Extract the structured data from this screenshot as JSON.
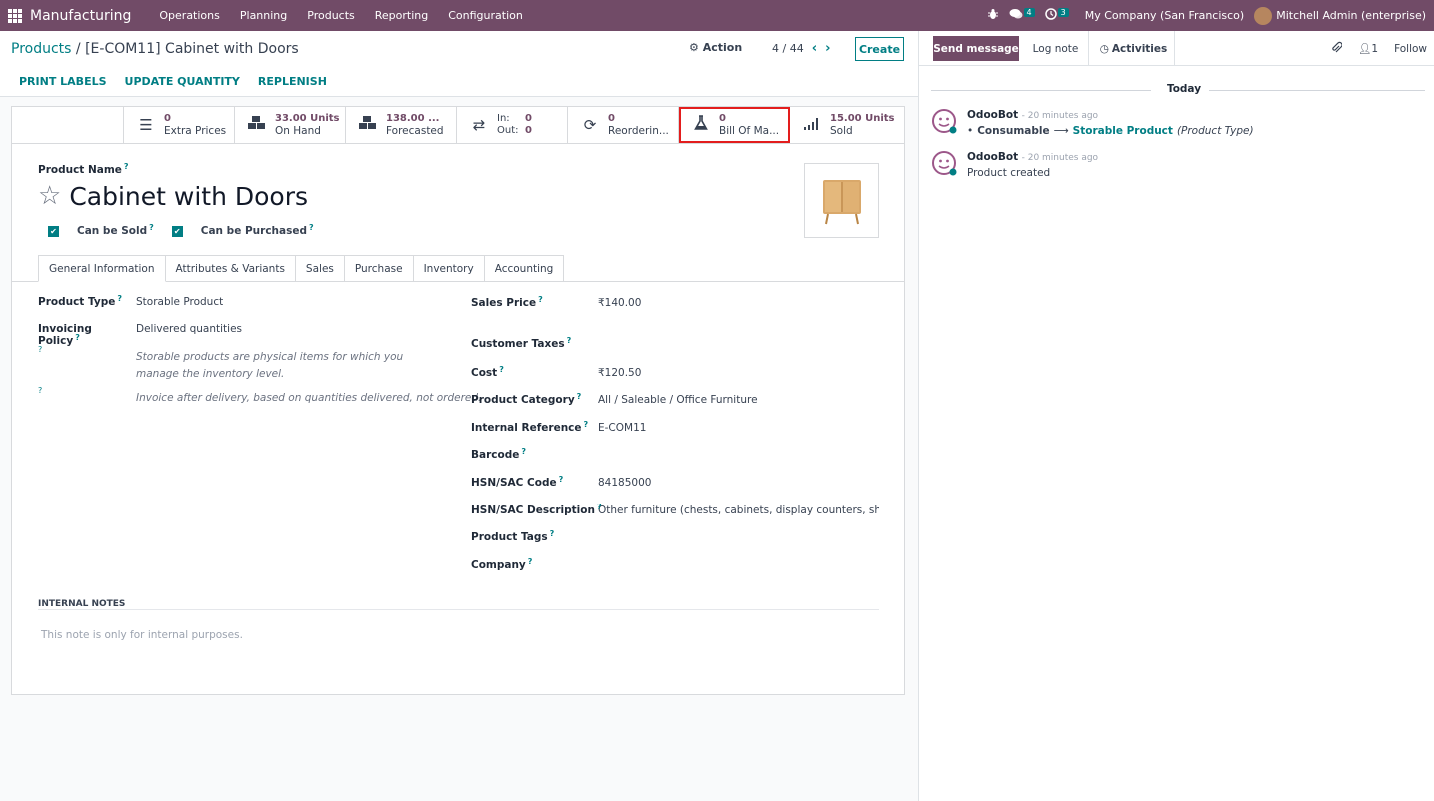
{
  "topbar": {
    "app_name": "Manufacturing",
    "menu": [
      "Operations",
      "Planning",
      "Products",
      "Reporting",
      "Configuration"
    ],
    "messages_count": "4",
    "activities_count": "3",
    "company": "My Company (San Francisco)",
    "user": "Mitchell Admin (enterprise)"
  },
  "control": {
    "breadcrumb_root": "Products",
    "breadcrumb_sep": "/",
    "breadcrumb_current": "[E-COM11] Cabinet with Doors",
    "action_label": "Action",
    "pager_value": "4 / 44",
    "create_label": "Create",
    "buttons": [
      "PRINT LABELS",
      "UPDATE QUANTITY",
      "REPLENISH"
    ]
  },
  "stats": {
    "extra_prices": {
      "value": "0",
      "label": "Extra Prices"
    },
    "on_hand": {
      "value": "33.00 Units",
      "label": "On Hand"
    },
    "forecasted": {
      "value": "138.00 ...",
      "label": "Forecasted"
    },
    "in_out": {
      "in_label": "In:",
      "in_value": "0",
      "out_label": "Out:",
      "out_value": "0"
    },
    "reordering": {
      "value": "0",
      "label": "Reorderin..."
    },
    "bom": {
      "value": "0",
      "label": "Bill Of Ma..."
    },
    "sold": {
      "value": "15.00 Units",
      "label": "Sold"
    }
  },
  "product": {
    "name_label": "Product Name",
    "help_mark": "?",
    "name": "Cabinet with Doors",
    "can_be_sold": "Can be Sold",
    "can_be_purchased": "Can be Purchased"
  },
  "tabs": [
    "General Information",
    "Attributes & Variants",
    "Sales",
    "Purchase",
    "Inventory",
    "Accounting"
  ],
  "general": {
    "product_type_label": "Product Type",
    "product_type": "Storable Product",
    "invoicing_policy_label": "Invoicing Policy",
    "invoicing_policy": "Delivered quantities",
    "help_type": "Storable products are physical items for which you manage the inventory level.",
    "help_invoice": "Invoice after delivery, based on quantities delivered, not ordered.",
    "sales_price_label": "Sales Price",
    "sales_price": "₹140.00",
    "customer_taxes_label": "Customer Taxes",
    "cost_label": "Cost",
    "cost": "₹120.50",
    "category_label": "Product Category",
    "category": "All / Saleable / Office Furniture",
    "internal_ref_label": "Internal Reference",
    "internal_ref": "E-COM11",
    "barcode_label": "Barcode",
    "hsn_code_label": "HSN/SAC Code",
    "hsn_code": "84185000",
    "hsn_desc_label": "HSN/SAC Description",
    "hsn_desc": "Other furniture (chests, cabinets, display counters, show-c",
    "tags_label": "Product Tags",
    "company_label": "Company"
  },
  "notes": {
    "title": "INTERNAL NOTES",
    "placeholder": "This note is only for internal purposes."
  },
  "chatter": {
    "send_message": "Send message",
    "log_note": "Log note",
    "activities": "Activities",
    "followers_count": "1",
    "follow": "Follow",
    "today": "Today",
    "messages": [
      {
        "author": "OdooBot",
        "time": "- 20 minutes ago",
        "old_value": "Consumable",
        "new_value": "Storable Product",
        "field": "(Product Type)"
      },
      {
        "author": "OdooBot",
        "time": "- 20 minutes ago",
        "body": "Product created"
      }
    ]
  },
  "colors": {
    "brand": "#714b67",
    "accent": "#017e84",
    "highlight": "#e31d1d"
  }
}
